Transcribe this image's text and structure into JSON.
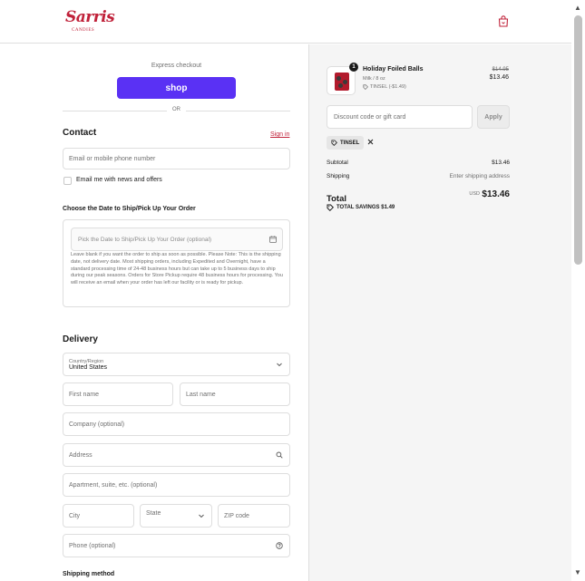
{
  "brand": {
    "name": "Sarris",
    "tagline": "CANDIES"
  },
  "express": {
    "label": "Express checkout",
    "shop_button": "shop",
    "or": "OR"
  },
  "contact": {
    "heading": "Contact",
    "signin": "Sign in",
    "email_placeholder": "Email or mobile phone number",
    "newsletter_label": "Email me with news and offers"
  },
  "ship_date": {
    "heading": "Choose the Date to Ship/Pick Up Your Order",
    "placeholder": "Pick the Date to Ship/Pick Up Your Order (optional)",
    "note": "Leave blank if you want the order to ship as soon as possible. Please Note: This is the shipping date, not delivery date. Most shipping orders, including Expedited and Overnight, have a standard processing time of 24-48 business hours but can take up to 5 business days to ship during our peak seasons. Orders for Store Pickup require 48 business hours for processing. You will receive an email when your order has left our facility or is ready for pickup."
  },
  "delivery": {
    "heading": "Delivery",
    "country_label": "Country/Region",
    "country_value": "United States",
    "first_name": "First name",
    "last_name": "Last name",
    "company": "Company (optional)",
    "address": "Address",
    "apartment": "Apartment, suite, etc. (optional)",
    "city": "City",
    "state": "State",
    "zip": "ZIP code",
    "phone": "Phone (optional)",
    "shipping_method": "Shipping method"
  },
  "summary": {
    "product": {
      "name": "Holiday Foiled Balls",
      "variant": "Milk / 8 oz",
      "discount_tag": "TINSEL (-$1.49)",
      "old_price": "$14.95",
      "price": "$13.46",
      "quantity": "1"
    },
    "discount_placeholder": "Discount code or gift card",
    "apply": "Apply",
    "applied_code": "TINSEL",
    "subtotal_label": "Subtotal",
    "subtotal": "$13.46",
    "shipping_label": "Shipping",
    "shipping_value": "Enter shipping address",
    "total_label": "Total",
    "currency": "USD",
    "total": "$13.46",
    "savings": "TOTAL SAVINGS  $1.49"
  },
  "colors": {
    "brand": "#c0223a",
    "shop": "#5a31f4",
    "border": "#dedede",
    "summary_bg": "#f5f5f5"
  }
}
